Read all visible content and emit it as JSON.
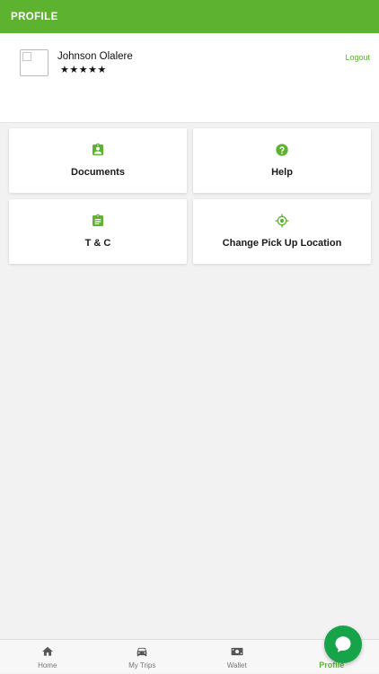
{
  "header": {
    "title": "PROFILE",
    "color": "#5db330"
  },
  "profile": {
    "name": "Johnson Olalere",
    "rating_stars": "★★★★★",
    "rating": 5,
    "logout_label": "Logout"
  },
  "tiles": [
    {
      "label": "Documents",
      "icon": "clipboard-account-icon"
    },
    {
      "label": "Help",
      "icon": "help-circle-icon"
    },
    {
      "label": "T & C",
      "icon": "clipboard-text-icon"
    },
    {
      "label": "Change Pick Up Location",
      "icon": "crosshairs-gps-icon"
    }
  ],
  "bottom_nav": {
    "items": [
      {
        "label": "Home",
        "icon": "home-icon",
        "active": false
      },
      {
        "label": "My Trips",
        "icon": "car-icon",
        "active": false
      },
      {
        "label": "Wallet",
        "icon": "wallet-cash-icon",
        "active": false
      },
      {
        "label": "Profile",
        "icon": "profile-icon",
        "active": true
      }
    ]
  },
  "chat": {
    "icon": "chat-bubble-icon",
    "color": "#16a34a"
  },
  "colors": {
    "accent": "#5db330",
    "background": "#f2f2f2",
    "card": "#ffffff",
    "inactive_nav": "#777777"
  }
}
